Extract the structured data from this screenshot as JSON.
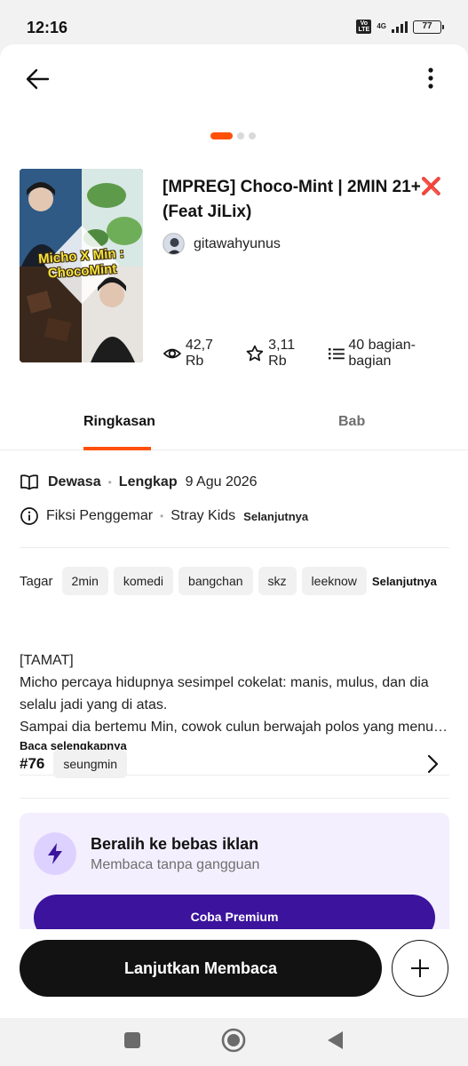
{
  "status_bar": {
    "time": "12:16",
    "volte": "Vo LTE",
    "network": "4G",
    "battery": "77"
  },
  "story": {
    "cover_text": "Micho X Min : ChocoMint",
    "title": "[MPREG] Choco-Mint | 2MIN 21+❌ (Feat JiLix)",
    "author": "gitawahyunus",
    "reads": "42,7 Rb",
    "votes": "3,11 Rb",
    "parts": "40 bagian-bagian"
  },
  "tabs": {
    "summary": "Ringkasan",
    "chapters": "Bab"
  },
  "meta": {
    "rating": "Dewasa",
    "status": "Lengkap",
    "date": "9 Agu 2026",
    "category": "Fiksi Penggemar",
    "fandom": "Stray Kids",
    "more": "Selanjutnya"
  },
  "tags": {
    "label": "Tagar",
    "items": [
      "2min",
      "komedi",
      "bangchan",
      "skz",
      "leeknow"
    ],
    "more": "Selanjutnya"
  },
  "description": {
    "lines": [
      "[TAMAT]",
      "Micho percaya hidupnya sesimpel cokelat: manis, mulus, dan dia",
      "selalu jadi yang di atas.",
      "Sampai dia bertemu Min, cowok culun berwajah polos yang menurut..."
    ],
    "read_more": "Baca selengkapnya"
  },
  "ranking": {
    "rank": "#76",
    "tag": "seungmin"
  },
  "premium": {
    "title": "Beralih ke bebas iklan",
    "subtitle": "Membaca tanpa gangguan",
    "button": "Coba Premium",
    "accent": "#3b139c"
  },
  "actions": {
    "continue": "Lanjutkan Membaca"
  },
  "colors": {
    "brand": "#ff500a",
    "text": "#121212"
  }
}
